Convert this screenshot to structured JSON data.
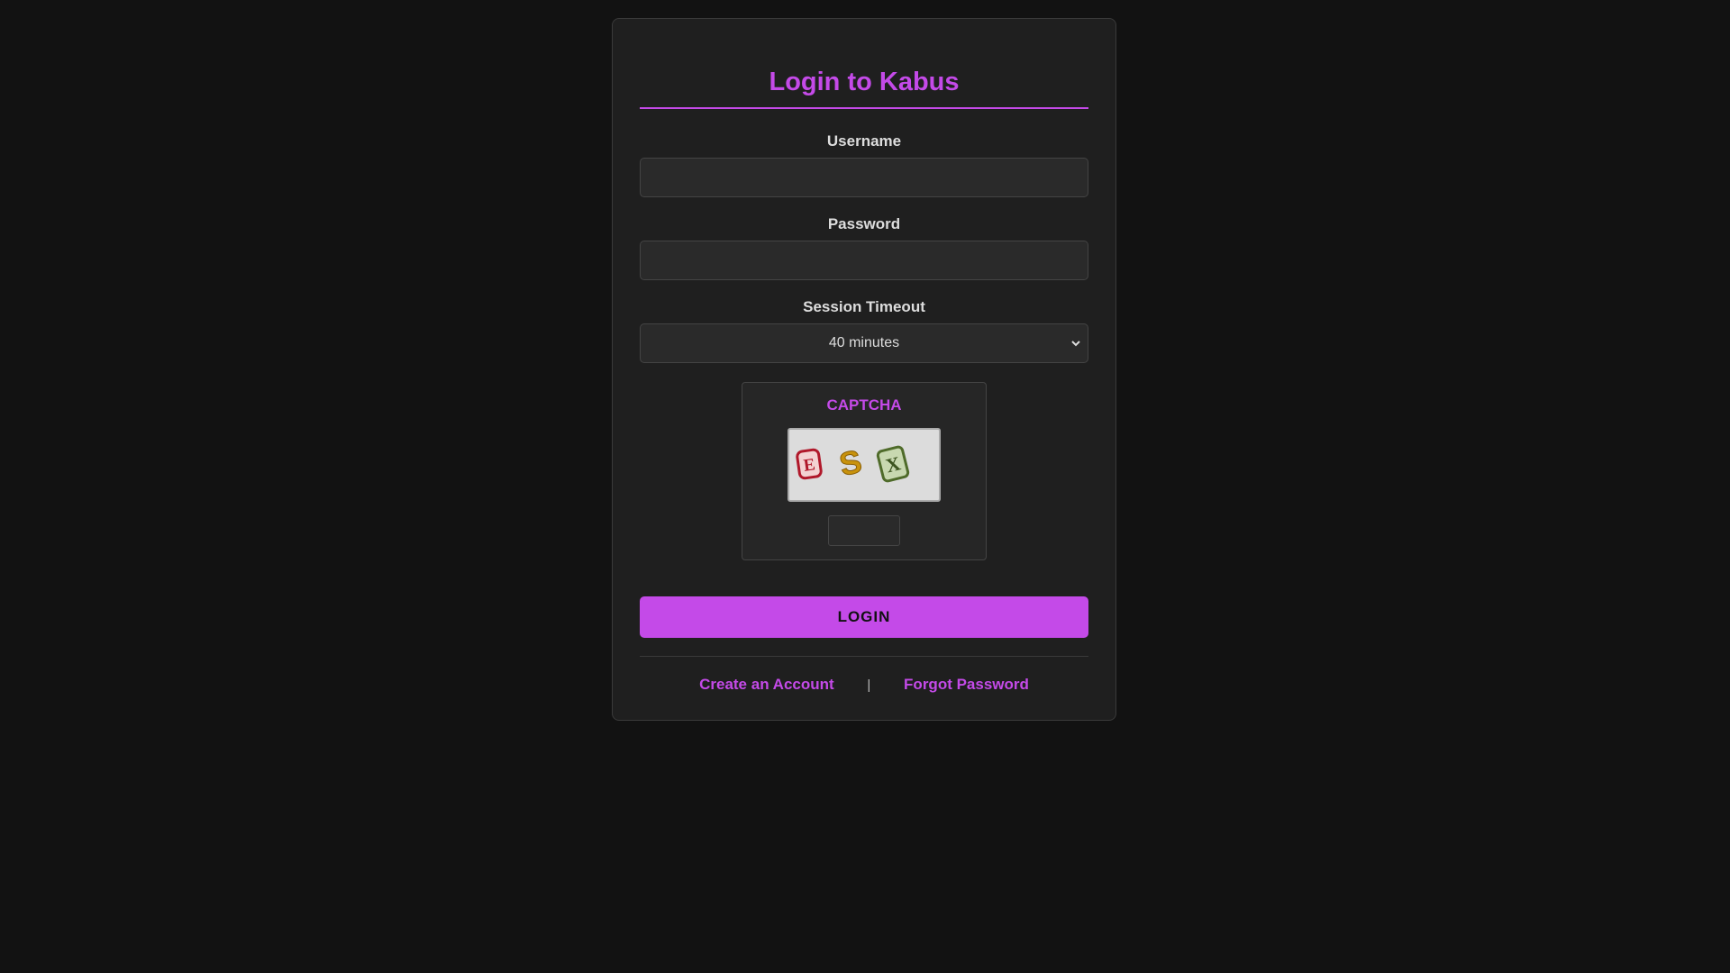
{
  "page": {
    "title": "Login to Kabus"
  },
  "form": {
    "username_label": "Username",
    "username_value": "",
    "password_label": "Password",
    "password_value": "",
    "timeout_label": "Session Timeout",
    "timeout_selected": "40 minutes",
    "captcha_title": "CAPTCHA",
    "captcha_characters": [
      "E",
      "S",
      "X"
    ],
    "captcha_value": "",
    "login_button": "LOGIN"
  },
  "links": {
    "create_account": "Create an Account",
    "separator": "|",
    "forgot_password": "Forgot Password"
  },
  "colors": {
    "accent": "#c44ae8",
    "background": "#121212",
    "card": "#1f1f1f"
  }
}
